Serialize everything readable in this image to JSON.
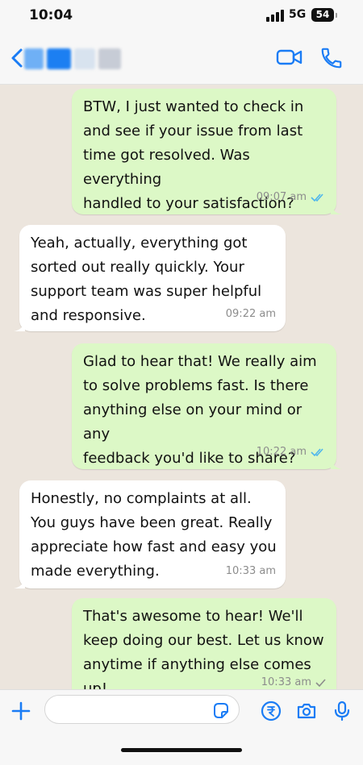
{
  "status_bar": {
    "time": "10:04",
    "network": "5G",
    "battery": "54"
  },
  "header": {
    "back_icon": "chevron-left-icon",
    "contact_name_hidden": true
  },
  "messages": [
    {
      "direction": "outgoing",
      "text": "BTW, I just wanted to check in\nand see if your issue from last\ntime got resolved. Was everything\nhandled to your satisfaction?",
      "time": "09:07 am",
      "read": true
    },
    {
      "direction": "incoming",
      "text": "Yeah, actually, everything got\nsorted out really quickly. Your\nsupport team was super helpful\nand responsive.",
      "time": "09:22 am"
    },
    {
      "direction": "outgoing",
      "text": "Glad to hear that! We really aim\nto solve problems fast. Is there\nanything else on your mind or any\nfeedback you'd like to share?",
      "time": "10:22 am",
      "read": true
    },
    {
      "direction": "incoming",
      "text": "Honestly, no complaints at all.\nYou guys have been great. Really\nappreciate how fast and easy you\nmade everything.",
      "time": "10:33 am"
    },
    {
      "direction": "outgoing",
      "text": "That's awesome to hear! We'll\nkeep doing our best. Let us know\nanytime if anything else comes up!",
      "time": "10:33 am",
      "read": false
    }
  ],
  "composer": {
    "input_value": "",
    "icons": [
      "plus-icon",
      "sticker-icon",
      "rupee-payment-icon",
      "camera-icon",
      "microphone-icon"
    ]
  },
  "colors": {
    "accent": "#1a7cf5",
    "outgoing_bubble": "#dcf8c6",
    "incoming_bubble": "#ffffff",
    "read_ticks": "#4fb6ec"
  }
}
